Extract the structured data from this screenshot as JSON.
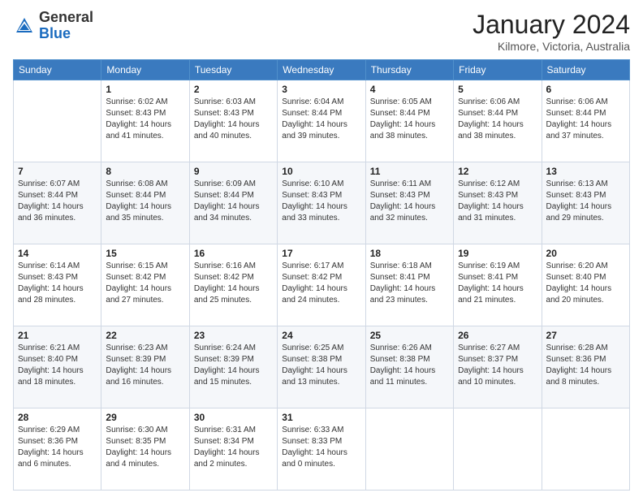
{
  "header": {
    "logo_general": "General",
    "logo_blue": "Blue",
    "month_title": "January 2024",
    "location": "Kilmore, Victoria, Australia"
  },
  "days_of_week": [
    "Sunday",
    "Monday",
    "Tuesday",
    "Wednesday",
    "Thursday",
    "Friday",
    "Saturday"
  ],
  "weeks": [
    [
      {
        "day": "",
        "info": ""
      },
      {
        "day": "1",
        "info": "Sunrise: 6:02 AM\nSunset: 8:43 PM\nDaylight: 14 hours\nand 41 minutes."
      },
      {
        "day": "2",
        "info": "Sunrise: 6:03 AM\nSunset: 8:43 PM\nDaylight: 14 hours\nand 40 minutes."
      },
      {
        "day": "3",
        "info": "Sunrise: 6:04 AM\nSunset: 8:44 PM\nDaylight: 14 hours\nand 39 minutes."
      },
      {
        "day": "4",
        "info": "Sunrise: 6:05 AM\nSunset: 8:44 PM\nDaylight: 14 hours\nand 38 minutes."
      },
      {
        "day": "5",
        "info": "Sunrise: 6:06 AM\nSunset: 8:44 PM\nDaylight: 14 hours\nand 38 minutes."
      },
      {
        "day": "6",
        "info": "Sunrise: 6:06 AM\nSunset: 8:44 PM\nDaylight: 14 hours\nand 37 minutes."
      }
    ],
    [
      {
        "day": "7",
        "info": "Sunrise: 6:07 AM\nSunset: 8:44 PM\nDaylight: 14 hours\nand 36 minutes."
      },
      {
        "day": "8",
        "info": "Sunrise: 6:08 AM\nSunset: 8:44 PM\nDaylight: 14 hours\nand 35 minutes."
      },
      {
        "day": "9",
        "info": "Sunrise: 6:09 AM\nSunset: 8:44 PM\nDaylight: 14 hours\nand 34 minutes."
      },
      {
        "day": "10",
        "info": "Sunrise: 6:10 AM\nSunset: 8:43 PM\nDaylight: 14 hours\nand 33 minutes."
      },
      {
        "day": "11",
        "info": "Sunrise: 6:11 AM\nSunset: 8:43 PM\nDaylight: 14 hours\nand 32 minutes."
      },
      {
        "day": "12",
        "info": "Sunrise: 6:12 AM\nSunset: 8:43 PM\nDaylight: 14 hours\nand 31 minutes."
      },
      {
        "day": "13",
        "info": "Sunrise: 6:13 AM\nSunset: 8:43 PM\nDaylight: 14 hours\nand 29 minutes."
      }
    ],
    [
      {
        "day": "14",
        "info": "Sunrise: 6:14 AM\nSunset: 8:43 PM\nDaylight: 14 hours\nand 28 minutes."
      },
      {
        "day": "15",
        "info": "Sunrise: 6:15 AM\nSunset: 8:42 PM\nDaylight: 14 hours\nand 27 minutes."
      },
      {
        "day": "16",
        "info": "Sunrise: 6:16 AM\nSunset: 8:42 PM\nDaylight: 14 hours\nand 25 minutes."
      },
      {
        "day": "17",
        "info": "Sunrise: 6:17 AM\nSunset: 8:42 PM\nDaylight: 14 hours\nand 24 minutes."
      },
      {
        "day": "18",
        "info": "Sunrise: 6:18 AM\nSunset: 8:41 PM\nDaylight: 14 hours\nand 23 minutes."
      },
      {
        "day": "19",
        "info": "Sunrise: 6:19 AM\nSunset: 8:41 PM\nDaylight: 14 hours\nand 21 minutes."
      },
      {
        "day": "20",
        "info": "Sunrise: 6:20 AM\nSunset: 8:40 PM\nDaylight: 14 hours\nand 20 minutes."
      }
    ],
    [
      {
        "day": "21",
        "info": "Sunrise: 6:21 AM\nSunset: 8:40 PM\nDaylight: 14 hours\nand 18 minutes."
      },
      {
        "day": "22",
        "info": "Sunrise: 6:23 AM\nSunset: 8:39 PM\nDaylight: 14 hours\nand 16 minutes."
      },
      {
        "day": "23",
        "info": "Sunrise: 6:24 AM\nSunset: 8:39 PM\nDaylight: 14 hours\nand 15 minutes."
      },
      {
        "day": "24",
        "info": "Sunrise: 6:25 AM\nSunset: 8:38 PM\nDaylight: 14 hours\nand 13 minutes."
      },
      {
        "day": "25",
        "info": "Sunrise: 6:26 AM\nSunset: 8:38 PM\nDaylight: 14 hours\nand 11 minutes."
      },
      {
        "day": "26",
        "info": "Sunrise: 6:27 AM\nSunset: 8:37 PM\nDaylight: 14 hours\nand 10 minutes."
      },
      {
        "day": "27",
        "info": "Sunrise: 6:28 AM\nSunset: 8:36 PM\nDaylight: 14 hours\nand 8 minutes."
      }
    ],
    [
      {
        "day": "28",
        "info": "Sunrise: 6:29 AM\nSunset: 8:36 PM\nDaylight: 14 hours\nand 6 minutes."
      },
      {
        "day": "29",
        "info": "Sunrise: 6:30 AM\nSunset: 8:35 PM\nDaylight: 14 hours\nand 4 minutes."
      },
      {
        "day": "30",
        "info": "Sunrise: 6:31 AM\nSunset: 8:34 PM\nDaylight: 14 hours\nand 2 minutes."
      },
      {
        "day": "31",
        "info": "Sunrise: 6:33 AM\nSunset: 8:33 PM\nDaylight: 14 hours\nand 0 minutes."
      },
      {
        "day": "",
        "info": ""
      },
      {
        "day": "",
        "info": ""
      },
      {
        "day": "",
        "info": ""
      }
    ]
  ]
}
